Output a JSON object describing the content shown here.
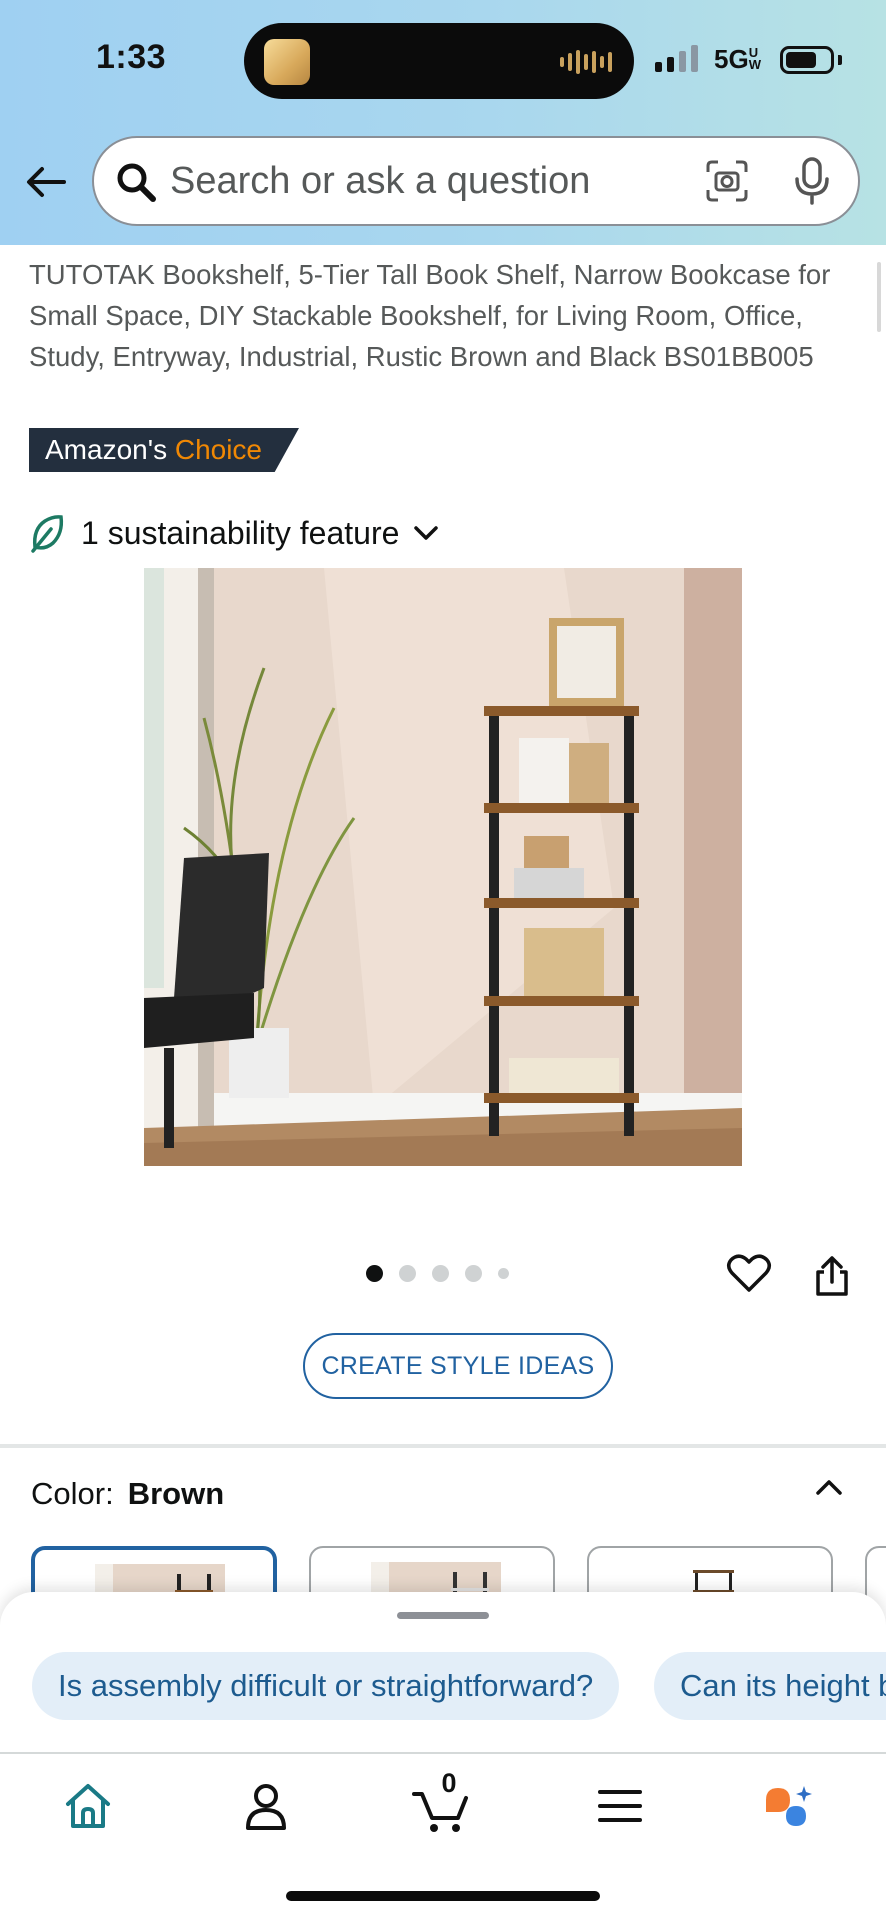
{
  "status_bar": {
    "time": "1:33",
    "network": "5G",
    "network_sub": "UW"
  },
  "search": {
    "placeholder": "Search or ask a question"
  },
  "product": {
    "title": "TUTOTAK Bookshelf, 5-Tier Tall Book Shelf, Narrow Bookcase for Small Space, DIY Stackable Bookshelf, for Living Room, Office, Study, Entryway, Industrial, Rustic Brown and Black BS01BB005",
    "badge_prefix": "Amazon's",
    "badge_highlight": "Choice",
    "sustainability_label": "1 sustainability feature",
    "image_count": 5,
    "image_active_index": 1
  },
  "actions": {
    "style_ideas_label": "CREATE STYLE IDEAS"
  },
  "color_selector": {
    "label": "Color:",
    "selected_value": "Brown"
  },
  "suggestions": [
    "Is assembly difficult or straightforward?",
    "Can its height b"
  ],
  "bottom_nav": {
    "cart_count": "0",
    "items": [
      "home-icon",
      "account-icon",
      "cart-icon",
      "menu-icon",
      "rufus-icon"
    ]
  },
  "colors": {
    "accent_blue": "#2162a1",
    "badge_bg": "#232f3e",
    "badge_highlight": "#f08804",
    "chip_bg": "#e3eef8"
  }
}
